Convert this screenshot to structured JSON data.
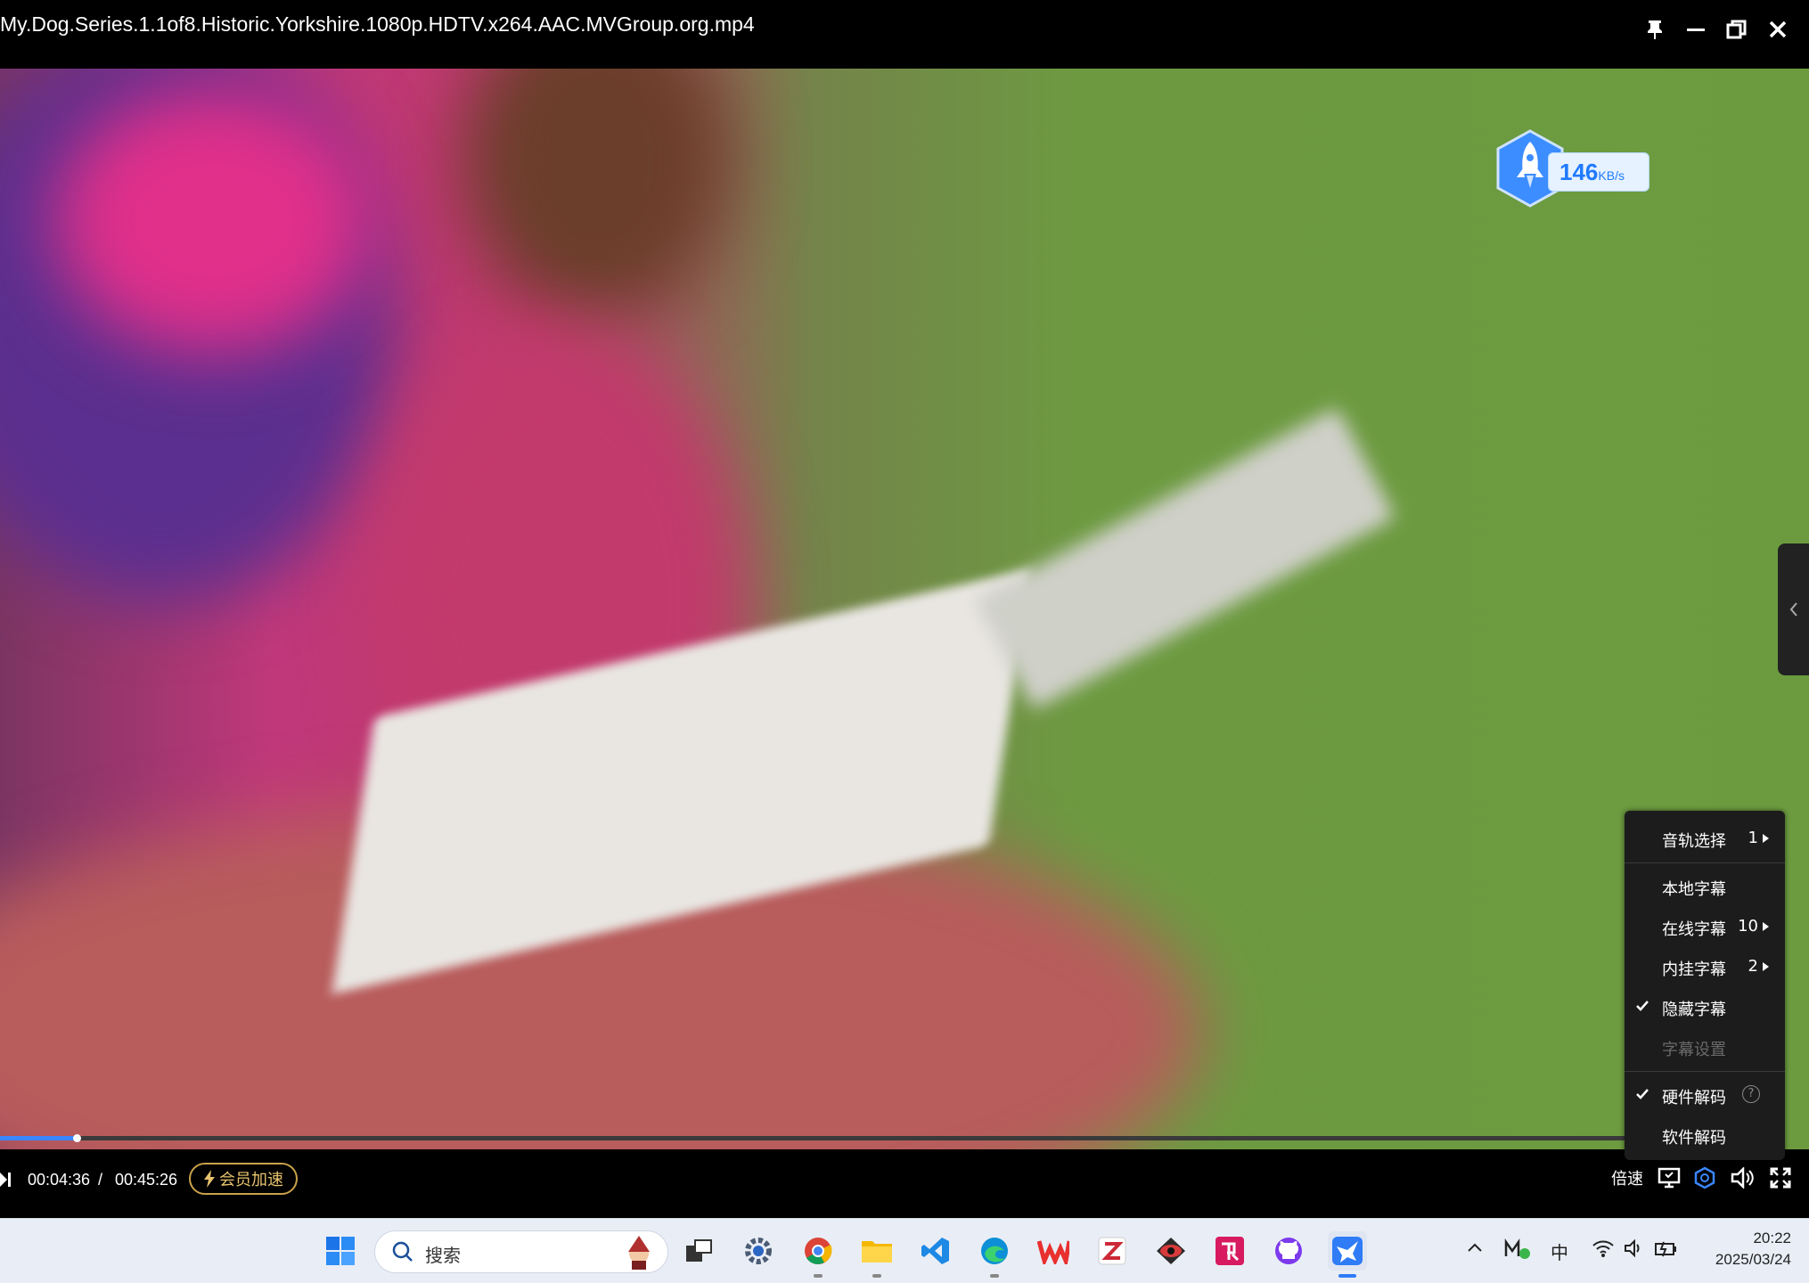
{
  "window": {
    "title": "My.Dog.Series.1.1of8.Historic.Yorkshire.1080p.HDTV.x264.AAC.MVGroup.org.mp4"
  },
  "speed_indicator": {
    "value": "146",
    "unit": "KB/s"
  },
  "player": {
    "current_time": "00:04:36",
    "separator": "/",
    "duration": "00:45:26",
    "progress_fraction": 0.0478,
    "vip_label": "会员加速",
    "speed_label": "倍速"
  },
  "context_menu": {
    "items": [
      {
        "label": "音轨选择",
        "value": "1",
        "submenu": true,
        "checked": false,
        "disabled": false
      },
      {
        "label": "本地字幕",
        "value": "",
        "submenu": false,
        "checked": false,
        "disabled": false
      },
      {
        "label": "在线字幕",
        "value": "10",
        "submenu": true,
        "checked": false,
        "disabled": false
      },
      {
        "label": "内挂字幕",
        "value": "2",
        "submenu": true,
        "checked": false,
        "disabled": false
      },
      {
        "label": "隐藏字幕",
        "value": "",
        "submenu": false,
        "checked": true,
        "disabled": false
      },
      {
        "label": "字幕设置",
        "value": "",
        "submenu": false,
        "checked": false,
        "disabled": true
      },
      {
        "label": "硬件解码",
        "value": "",
        "submenu": false,
        "checked": true,
        "disabled": false,
        "help": "?"
      },
      {
        "label": "软件解码",
        "value": "",
        "submenu": false,
        "checked": false,
        "disabled": false
      }
    ]
  },
  "taskbar": {
    "search_placeholder": "搜索",
    "ime_label": "中",
    "time": "20:22",
    "date": "2025/03/24"
  },
  "colors": {
    "accent": "#3a86ff",
    "vip": "#e8c36d",
    "menu_bg": "#1c1c1c"
  }
}
